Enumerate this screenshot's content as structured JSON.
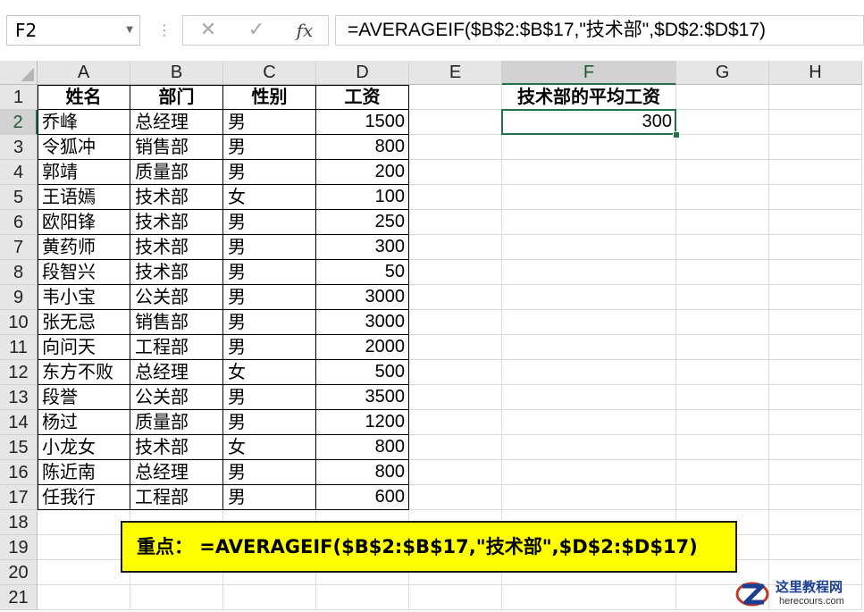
{
  "formula_bar": {
    "name_box": "F2",
    "cancel_symbol": "✕",
    "enter_symbol": "✓",
    "fx_label": "fx",
    "formula": "=AVERAGEIF($B$2:$B$17,\"技术部\",$D$2:$D$17)"
  },
  "sheet": {
    "columns": [
      "A",
      "B",
      "C",
      "D",
      "E",
      "F",
      "G",
      "H"
    ],
    "row_numbers": [
      "1",
      "2",
      "3",
      "4",
      "5",
      "6",
      "7",
      "8",
      "9",
      "10",
      "11",
      "12",
      "13",
      "14",
      "15",
      "16",
      "17",
      "18",
      "19",
      "20",
      "21"
    ],
    "selected_cell": "F2",
    "table_headers": [
      "姓名",
      "部门",
      "性别",
      "工资"
    ],
    "rows": [
      [
        "乔峰",
        "总经理",
        "男",
        "1500"
      ],
      [
        "令狐冲",
        "销售部",
        "男",
        "800"
      ],
      [
        "郭靖",
        "质量部",
        "男",
        "200"
      ],
      [
        "王语嫣",
        "技术部",
        "女",
        "100"
      ],
      [
        "欧阳锋",
        "技术部",
        "男",
        "250"
      ],
      [
        "黄药师",
        "技术部",
        "男",
        "300"
      ],
      [
        "段智兴",
        "技术部",
        "男",
        "50"
      ],
      [
        "韦小宝",
        "公关部",
        "男",
        "3000"
      ],
      [
        "张无忌",
        "销售部",
        "男",
        "3000"
      ],
      [
        "向问天",
        "工程部",
        "男",
        "2000"
      ],
      [
        "东方不败",
        "总经理",
        "女",
        "500"
      ],
      [
        "段誉",
        "公关部",
        "男",
        "3500"
      ],
      [
        "杨过",
        "质量部",
        "男",
        "1200"
      ],
      [
        "小龙女",
        "技术部",
        "女",
        "800"
      ],
      [
        "陈近南",
        "总经理",
        "男",
        "800"
      ],
      [
        "任我行",
        "工程部",
        "男",
        "600"
      ]
    ],
    "result_header": "技术部的平均工资",
    "result_value": "300"
  },
  "note": {
    "text": "重点： =AVERAGEIF($B$2:$B$17,\"技术部\",$D$2:$D$17)"
  },
  "watermark": {
    "title": "这里教程网",
    "url": "herecours.com"
  },
  "colors": {
    "excel_green": "#217346",
    "note_yellow": "#ffff00",
    "header_gray": "#e6e6e6"
  }
}
